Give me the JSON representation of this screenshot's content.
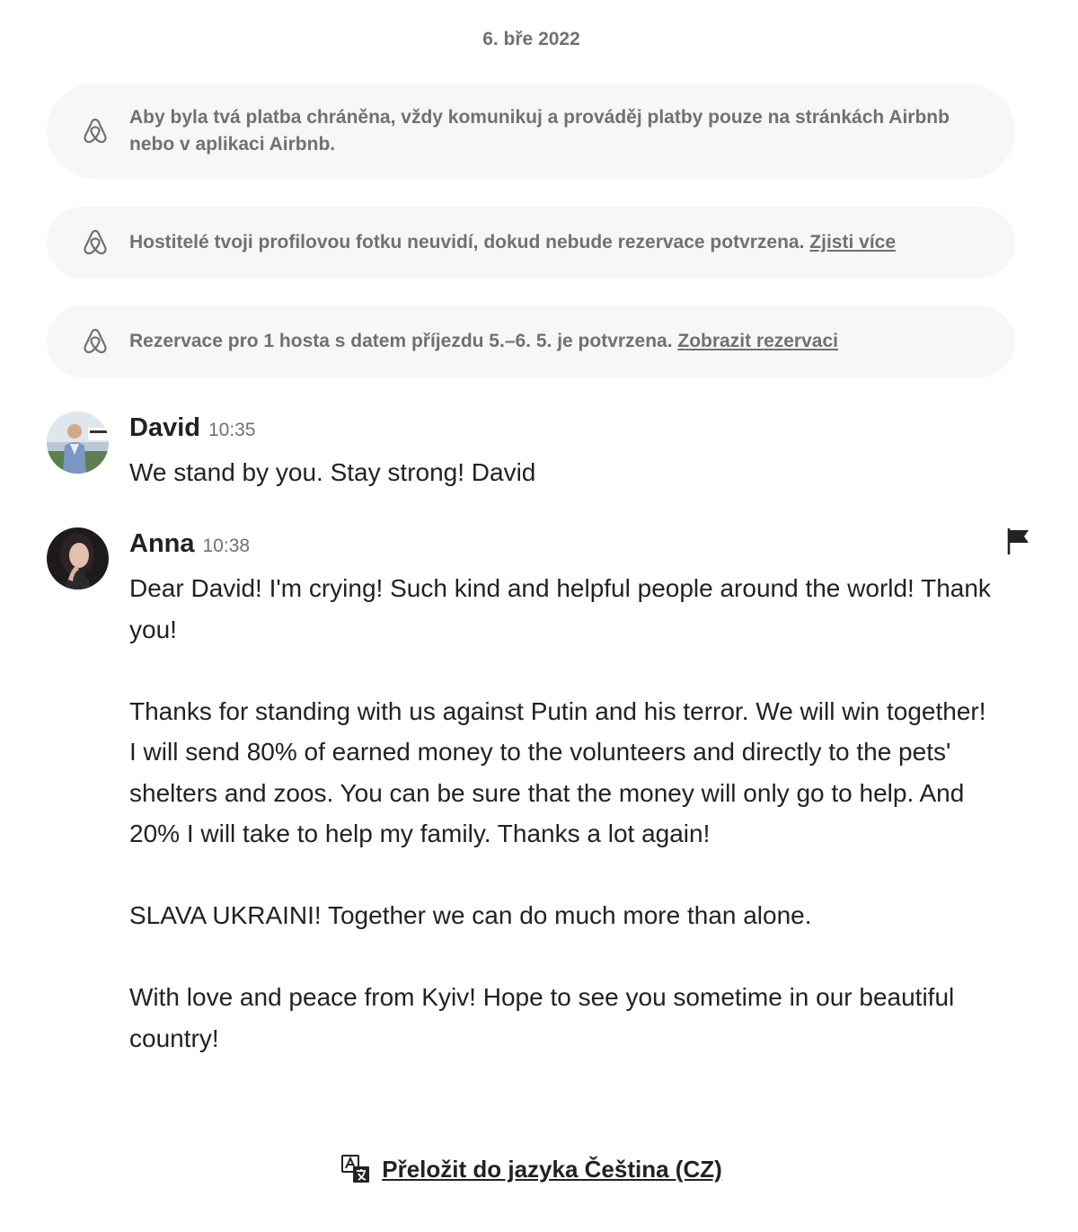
{
  "thread": {
    "date": "6. bře 2022",
    "notices": [
      {
        "icon": "airbnb-logo-icon",
        "text": "Aby byla tvá platba chráněna, vždy komunikuj a prováděj platby pouze na stránkách Airbnb nebo v aplikaci Airbnb.",
        "link": ""
      },
      {
        "icon": "airbnb-logo-icon",
        "text": "Hostitelé tvoji profilovou fotku neuvidí, dokud nebude rezervace potvrzena.",
        "link": "Zjisti více"
      },
      {
        "icon": "airbnb-logo-icon",
        "text": "Rezervace pro 1 hosta s datem příjezdu 5.–6. 5. je potvrzena.",
        "link": "Zobrazit rezervaci"
      }
    ]
  },
  "messages": [
    {
      "sender": "David",
      "time": "10:35",
      "paragraphs": [
        "We stand by you. Stay strong! David"
      ]
    },
    {
      "sender": "Anna",
      "time": "10:38",
      "paragraphs": [
        "Dear David! I'm crying! Such kind and helpful people around the world! Thank you!",
        "Thanks for standing with us against Putin and his terror. We will win together! I will send 80% of earned money to the volunteers and directly to the pets' shelters and zoos. You can be sure that the money will only go to help. And 20% I will take to help my family. Thanks a lot again!",
        "SLAVA UKRAINI! Together we can do much more than alone.",
        "With love and peace from Kyiv! Hope to see you sometime in our beautiful country!"
      ]
    }
  ],
  "icons": {
    "notice": "airbnb-logo-icon",
    "report": "flag-icon",
    "translate": "translate-icon"
  },
  "translate": {
    "label": "Přeložit do jazyka Čeština (CZ)"
  },
  "colors": {
    "text": "#222222",
    "muted": "#717171",
    "notice_bg": "#f7f7f7"
  }
}
